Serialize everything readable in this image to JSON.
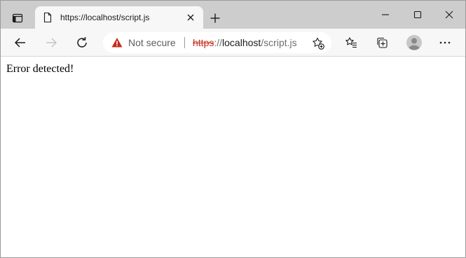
{
  "tab": {
    "title": "https://localhost/script.js"
  },
  "address_bar": {
    "security_label": "Not secure",
    "url_scheme": "https",
    "url_separator": "://",
    "url_host": "localhost",
    "url_path": "/script.js"
  },
  "page": {
    "message": "Error detected!"
  },
  "colors": {
    "tabstrip_bg": "#cdcdcd",
    "toolbar_bg": "#f7f7f7",
    "warning": "#c42b1c",
    "text": "#1b1b1b"
  },
  "icons": {
    "tab_actions": "tab-actions-icon",
    "favicon": "document-icon",
    "tab_close": "close-icon",
    "new_tab": "plus-icon",
    "minimize": "minimize-icon",
    "maximize": "maximize-icon",
    "close_window": "close-icon",
    "back": "back-arrow-icon",
    "forward": "forward-arrow-icon",
    "refresh": "refresh-icon",
    "security": "warning-triangle-icon",
    "add_favorite": "star-plus-icon",
    "favorites": "favorites-list-icon",
    "collections": "collections-icon",
    "profile": "profile-avatar-icon",
    "menu": "more-dots-icon"
  }
}
